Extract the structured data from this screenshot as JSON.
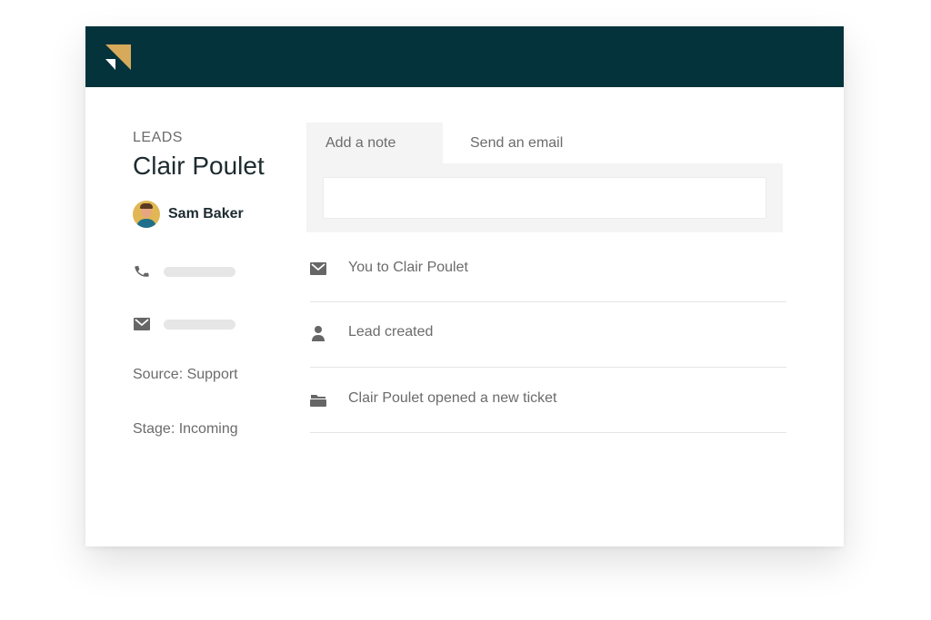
{
  "colors": {
    "header_bg": "#04333b",
    "logo_gold": "#d6aa5a",
    "logo_white": "#ffffff",
    "text_dark": "#1d2b30",
    "text_muted": "#6b6b6b",
    "panel_bg": "#f4f4f4",
    "icon_gray": "#666666"
  },
  "header": {
    "logo_icon": "brand-logo-icon"
  },
  "lead": {
    "section_label": "LEADS",
    "name": "Clair Poulet",
    "owner": {
      "name": "Sam Baker",
      "avatar_icon": "avatar-photo"
    },
    "contacts": [
      {
        "icon": "phone-icon",
        "value": ""
      },
      {
        "icon": "envelope-icon",
        "value": ""
      }
    ],
    "source": "Source: Support",
    "stage": "Stage: Incoming"
  },
  "composer": {
    "tabs": [
      {
        "label": "Add a note",
        "active": true
      },
      {
        "label": "Send an email",
        "active": false
      }
    ],
    "input_value": "",
    "input_placeholder": ""
  },
  "activity": [
    {
      "icon": "envelope-icon",
      "text": "You to Clair Poulet"
    },
    {
      "icon": "user-icon",
      "text": "Lead created"
    },
    {
      "icon": "folder-icon",
      "text": "Clair Poulet opened a new ticket"
    }
  ]
}
